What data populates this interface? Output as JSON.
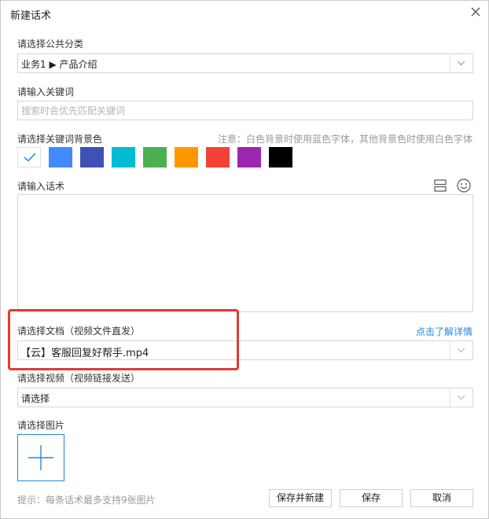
{
  "dialog": {
    "title": "新建话术",
    "close_icon": "close-icon"
  },
  "public_category": {
    "label": "请选择公共分类",
    "value": "业务1 ▶ 产品介绍"
  },
  "keyword": {
    "label": "请输入关键词",
    "placeholder": "搜索时会优先匹配关键词",
    "value": ""
  },
  "keyword_color": {
    "label": "请选择关键词背景色",
    "note": "注意：白色背景时使用蓝色字体，其他背景色时使用白色字体",
    "selected": "#ffffff",
    "colors": [
      "#ffffff",
      "#448aff",
      "#3f51b5",
      "#00bcd4",
      "#4caf50",
      "#ff9800",
      "#f44336",
      "#9c27b0",
      "#000000"
    ]
  },
  "script": {
    "label": "请输入话术",
    "toolbar_icons": [
      "layout-icon",
      "emoji-icon"
    ],
    "value": ""
  },
  "document": {
    "label": "请选择文档（视频文件直发）",
    "link": "点击了解详情",
    "value": "【云】客服回复好帮手.mp4"
  },
  "video": {
    "label": "请选择视频（视频链接发送）",
    "value": "请选择"
  },
  "image": {
    "label": "请选择图片",
    "add_icon": "plus-icon"
  },
  "footer": {
    "hint": "提示：每条话术最多支持9张图片",
    "save_new_label": "保存并新建",
    "save_label": "保存",
    "cancel_label": "取消"
  },
  "colors": {
    "accent": "#1e88e5",
    "highlight": "#e53935"
  }
}
